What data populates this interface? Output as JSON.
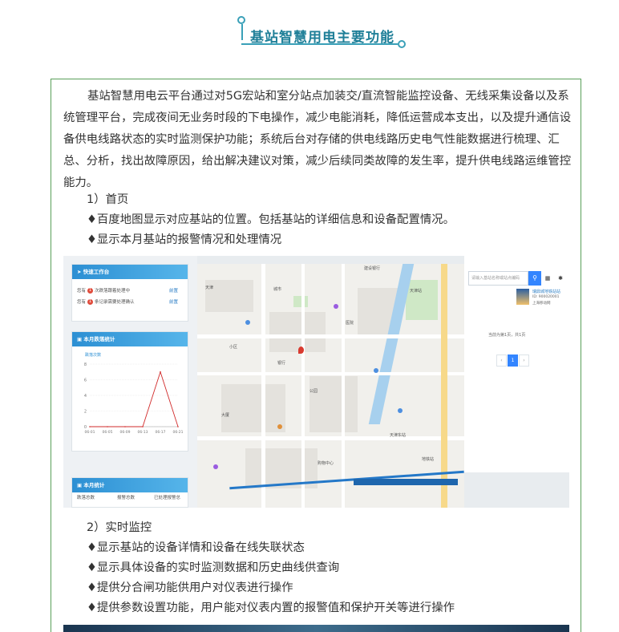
{
  "header": {
    "title": "基站智慧用电主要功能"
  },
  "intro": "基站智慧用电云平台通过对5G宏站和室分站点加装交/直流智能监控设备、无线采集设备以及系统管理平台，完成夜间无业务时段的下电操作，减少电能消耗，降低运营成本支出，以及提升通信设备供电线路状态的实时监测保护功能；系统后台对存储的供电线路历史电气性能数据进行梳理、汇总、分析，找出故障原因，给出解决建议对策，减少后续同类故障的发生率，提升供电线路运维管控能力。",
  "section1": {
    "heading": "1）首页",
    "bullets": [
      "♦百度地图显示对应基站的位置。包括基站的详细信息和设备配置情况。",
      "♦显示本月基站的报警情况和处理情况"
    ]
  },
  "screenshot": {
    "quick_panel": {
      "title": "快速工作台",
      "items": [
        {
          "prefix": "您有",
          "count": "1",
          "text": "次跌落跟着处理中",
          "link": "前置"
        },
        {
          "prefix": "您有",
          "count": "1",
          "text": "条记录需要处理确认",
          "link": "前置"
        }
      ]
    },
    "alarm_panel": {
      "title": "本月跌落统计",
      "legend": "跌落次数",
      "yticks": [
        "8",
        "6",
        "4",
        "2",
        "0"
      ],
      "xticks": [
        "06-01",
        "06-05",
        "06-09",
        "06-13",
        "06-17",
        "06-21"
      ]
    },
    "stats_panel": {
      "title": "本月统计",
      "cols": [
        "跌落总数",
        "报警总数",
        "已处理报警总"
      ]
    },
    "map_labels": [
      "建设银行",
      "天津",
      "城市",
      "医院",
      "小区",
      "公园",
      "天津站",
      "地铁站",
      "大厦",
      "天津东站",
      "银行",
      "购物中心"
    ],
    "search": {
      "placeholder": "请输入基站名称或站点编码",
      "button": "⚲",
      "result_name": "瑞鼎城地铁站站",
      "result_meta1": "ID: 900020001",
      "result_meta2": "上海移动网",
      "count_text": "当前为第1页，共1页",
      "pages": [
        "‹",
        "1",
        "›"
      ]
    },
    "chart_data": {
      "type": "line",
      "title": "本月跌落统计",
      "xlabel": "",
      "ylabel": "跌落次数",
      "x": [
        "06-01",
        "06-05",
        "06-09",
        "06-13",
        "06-17",
        "06-21"
      ],
      "series": [
        {
          "name": "跌落次数",
          "values": [
            0,
            0,
            0,
            0,
            7,
            0
          ]
        }
      ],
      "ylim": [
        0,
        8
      ]
    }
  },
  "section2": {
    "heading": "2）实时监控",
    "bullets": [
      "♦显示基站的设备详情和设备在线失联状态",
      "♦显示具体设备的实时监测数据和历史曲线供查询",
      "♦提供分合闸功能供用户对仪表进行操作",
      "♦提供参数设置功能，用户能对仪表内置的报警值和保护开关等进行操作"
    ]
  },
  "colors": {
    "title": "#1f7f98",
    "border": "#5aa05a",
    "accent": "#2c8fd3",
    "alarm": "#d12b2b"
  }
}
